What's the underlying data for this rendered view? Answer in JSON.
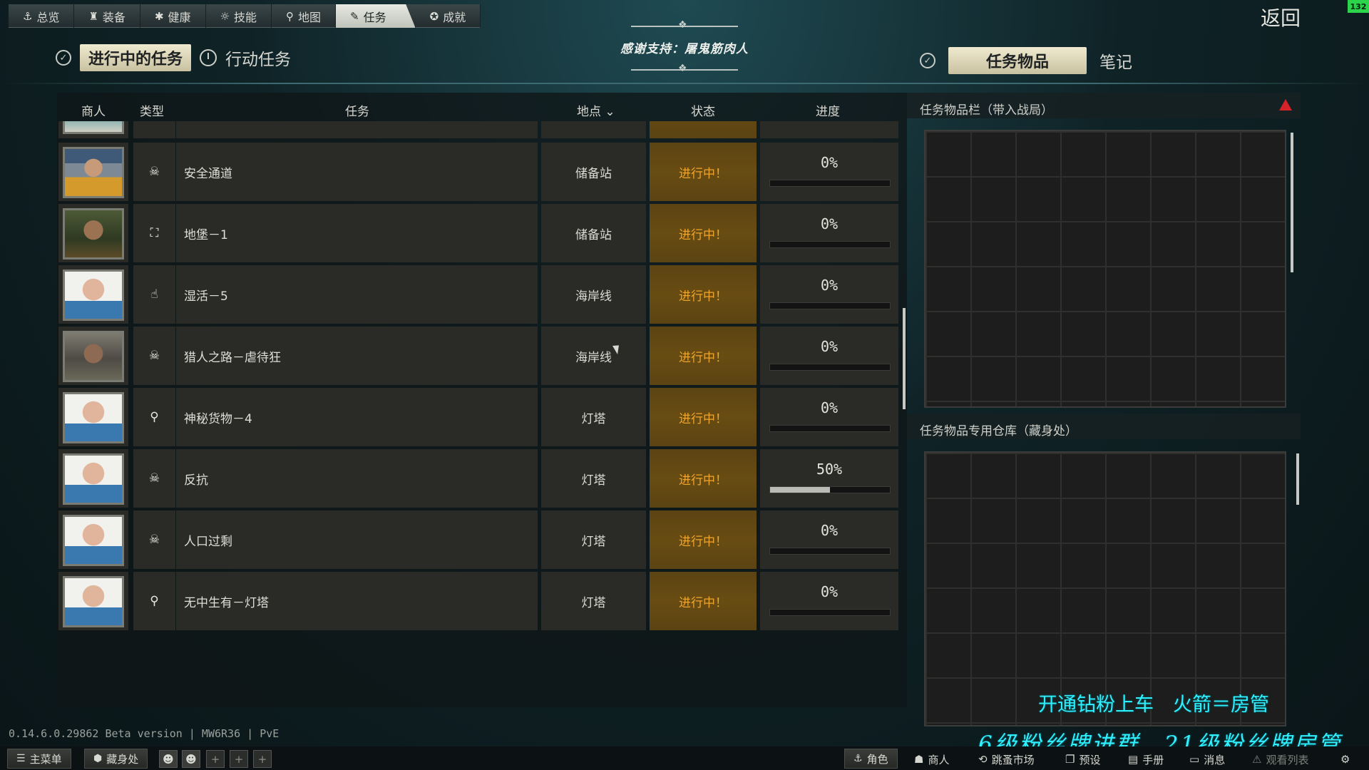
{
  "nav": {
    "tabs": [
      {
        "label": "总览",
        "icon": "anchor-icon"
      },
      {
        "label": "装备",
        "icon": "gear-equip-icon"
      },
      {
        "label": "健康",
        "icon": "health-icon"
      },
      {
        "label": "技能",
        "icon": "skills-icon"
      },
      {
        "label": "地图",
        "icon": "map-pin-icon"
      },
      {
        "label": "任务",
        "icon": "quest-icon",
        "active": true
      },
      {
        "label": "成就",
        "icon": "achievement-icon"
      }
    ],
    "back_label": "返回",
    "fps": "132"
  },
  "header": {
    "active_tab": "进行中的任务",
    "action_tab": "行动任务",
    "thanks": "感谢支持：屠鬼筋肉人",
    "items_tab": "任务物品",
    "notes_tab": "笔记"
  },
  "table": {
    "columns": {
      "trader": "商人",
      "type": "类型",
      "task": "任务",
      "location": "地点",
      "status": "状态",
      "progress": "进度"
    },
    "sort_indicator": "⌄",
    "rows": [
      {
        "type_icon": "skull-icon",
        "type_glyph": "☠",
        "name": "安全通道",
        "location": "储备站",
        "status": "进行中！",
        "progress_text": "0%",
        "progress": 0,
        "trader": "trader-a"
      },
      {
        "type_icon": "exit-icon",
        "type_glyph": "⛶",
        "name": "地堡－1",
        "location": "储备站",
        "status": "进行中！",
        "progress_text": "0%",
        "progress": 0,
        "trader": "trader-b"
      },
      {
        "type_icon": "hand-icon",
        "type_glyph": "☝",
        "name": "湿活－5",
        "location": "海岸线",
        "status": "进行中！",
        "progress_text": "0%",
        "progress": 0,
        "trader": "trader-c"
      },
      {
        "type_icon": "skull-icon",
        "type_glyph": "☠",
        "name": "猎人之路－虐待狂",
        "location": "海岸线",
        "status": "进行中！",
        "progress_text": "0%",
        "progress": 0,
        "trader": "trader-d"
      },
      {
        "type_icon": "map-pin-icon",
        "type_glyph": "⚲",
        "name": "神秘货物－4",
        "location": "灯塔",
        "status": "进行中！",
        "progress_text": "0%",
        "progress": 0,
        "trader": "trader-c"
      },
      {
        "type_icon": "skull-icon",
        "type_glyph": "☠",
        "name": "反抗",
        "location": "灯塔",
        "status": "进行中！",
        "progress_text": "50%",
        "progress": 0.5,
        "trader": "trader-c"
      },
      {
        "type_icon": "skull-icon",
        "type_glyph": "☠",
        "name": "人口过剩",
        "location": "灯塔",
        "status": "进行中！",
        "progress_text": "0%",
        "progress": 0,
        "trader": "trader-c"
      },
      {
        "type_icon": "map-pin-icon",
        "type_glyph": "⚲",
        "name": "无中生有－灯塔",
        "location": "灯塔",
        "status": "进行中！",
        "progress_text": "0%",
        "progress": 0,
        "trader": "trader-c"
      }
    ]
  },
  "items_panel": {
    "carry_title": "任务物品栏（带入战局）",
    "stash_title": "任务物品专用仓库（藏身处）"
  },
  "overlay": {
    "promo_line1": "开通钻粉上车　火箭＝房管",
    "promo_line2": "6级粉丝牌进群　21级粉丝牌房管"
  },
  "footer": {
    "version": "0.14.6.0.29862 Beta version | MW6R36 | PvE",
    "main_menu": "主菜单",
    "hideout": "藏身处",
    "character": "角色",
    "traders": "商人",
    "flea": "跳蚤市场",
    "presets": "预设",
    "handbook": "手册",
    "messages": "消息",
    "watchlist": "观看列表"
  },
  "colors": {
    "status_text": "#f0a52e",
    "status_bg": "#684c12",
    "promo": "#2ff0ff",
    "warning": "#d6232a"
  }
}
